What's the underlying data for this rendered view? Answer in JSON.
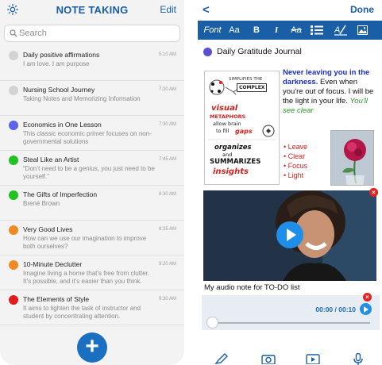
{
  "left": {
    "title": "NOTE TAKING",
    "edit_label": "Edit",
    "search_placeholder": "Search",
    "notes": [
      {
        "title": "Daily positive affirmations",
        "time": "5:10 AM",
        "preview": "I am love. I am purpose",
        "color": "#d3d3d3"
      },
      {
        "title": "Nursing School Journey",
        "time": "7:20 AM",
        "preview": "Taking Notes and Memorizing Information",
        "color": "#d3d3d3"
      },
      {
        "title": "Economics in One Lesson",
        "time": "7:30 AM",
        "preview": "This classic economic primer focuses on non-governmental solutions",
        "color": "#5b63e8"
      },
      {
        "title": "Steal Like an Artist",
        "time": "7:45 AM",
        "preview": "“Don’t need to be a genius, you just need to be yourself.”",
        "color": "#1fc21f"
      },
      {
        "title": "The Gifts of Imperfection",
        "time": "8:30 AM",
        "preview": "Brené Brown",
        "color": "#1fc21f"
      },
      {
        "title": "Very Good Lives",
        "time": "8:35 AM",
        "preview": "How can we use our imagination to improve both ourselves?",
        "color": "#f08a24"
      },
      {
        "title": "10-Minute Declutter",
        "time": "9:20 AM",
        "preview": "Imagine living a home that’s free from clutter. It’s possible, and it’s easier than you think.",
        "color": "#f08a24"
      },
      {
        "title": "The Elements of Style",
        "time": "9:30 AM",
        "preview": "It aims to lighten the task of instructor and student by concentrating attention.",
        "color": "#e31b1b"
      }
    ],
    "add_label": "+"
  },
  "right": {
    "back_label": "<",
    "done_label": "Done",
    "toolbar": {
      "font": "Font",
      "size": "Aa",
      "bold": "B",
      "italic": "I",
      "strike": "Aa",
      "list_icon": "list-icon",
      "format_icon": "text-format-icon",
      "image_icon": "image-icon"
    },
    "doc_title": "Daily Gratitude Journal",
    "doc_color": "#5b4fd4",
    "sketch": {
      "l1": "SIMPLIFIES THE",
      "l2": "COMPLEX",
      "l3": "visual",
      "l4": "METAPHORS",
      "l5": "allow brain",
      "l6": "to fill",
      "l7": "gaps",
      "l8": "organizes",
      "l9": "and",
      "l10": "SUMMARIZES",
      "l11": "insights"
    },
    "quote": {
      "blue": "Never leaving you in the darkness.",
      "plain": " Even when you're out of focus. I will be the light in your life.",
      "green": "You'll see clear"
    },
    "bullets": [
      "Leave",
      "Clear",
      "Focus",
      "Light"
    ],
    "audio_label": "My audio note for TO-DO list",
    "audio_time": "00:00 / 00:10",
    "audio_progress": 0
  }
}
